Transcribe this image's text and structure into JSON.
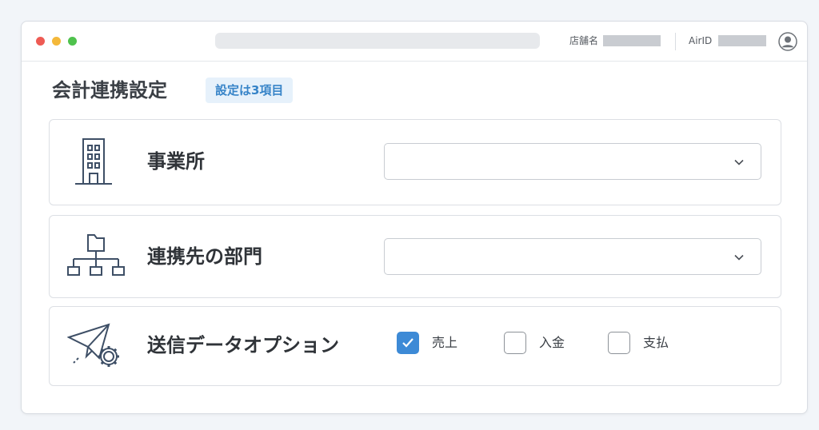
{
  "header": {
    "store_label": "店舗名",
    "airid_label": "AirID"
  },
  "page": {
    "title": "会計連携設定",
    "badge": "設定は3項目"
  },
  "settings": [
    {
      "label": "事業所",
      "control": "select",
      "value": "",
      "icon": "office-building-icon"
    },
    {
      "label": "連携先の部門",
      "control": "select",
      "value": "",
      "icon": "org-chart-folder-icon"
    },
    {
      "label": "送信データオプション",
      "control": "checkboxes",
      "icon": "paper-plane-gear-icon"
    }
  ],
  "options": [
    {
      "label": "売上",
      "checked": true
    },
    {
      "label": "入金",
      "checked": false
    },
    {
      "label": "支払",
      "checked": false
    }
  ],
  "colors": {
    "accent": "#3d8ad6",
    "badge_bg": "#e6f1fb",
    "badge_text": "#3784c8",
    "icon_stroke": "#3e4f66"
  }
}
